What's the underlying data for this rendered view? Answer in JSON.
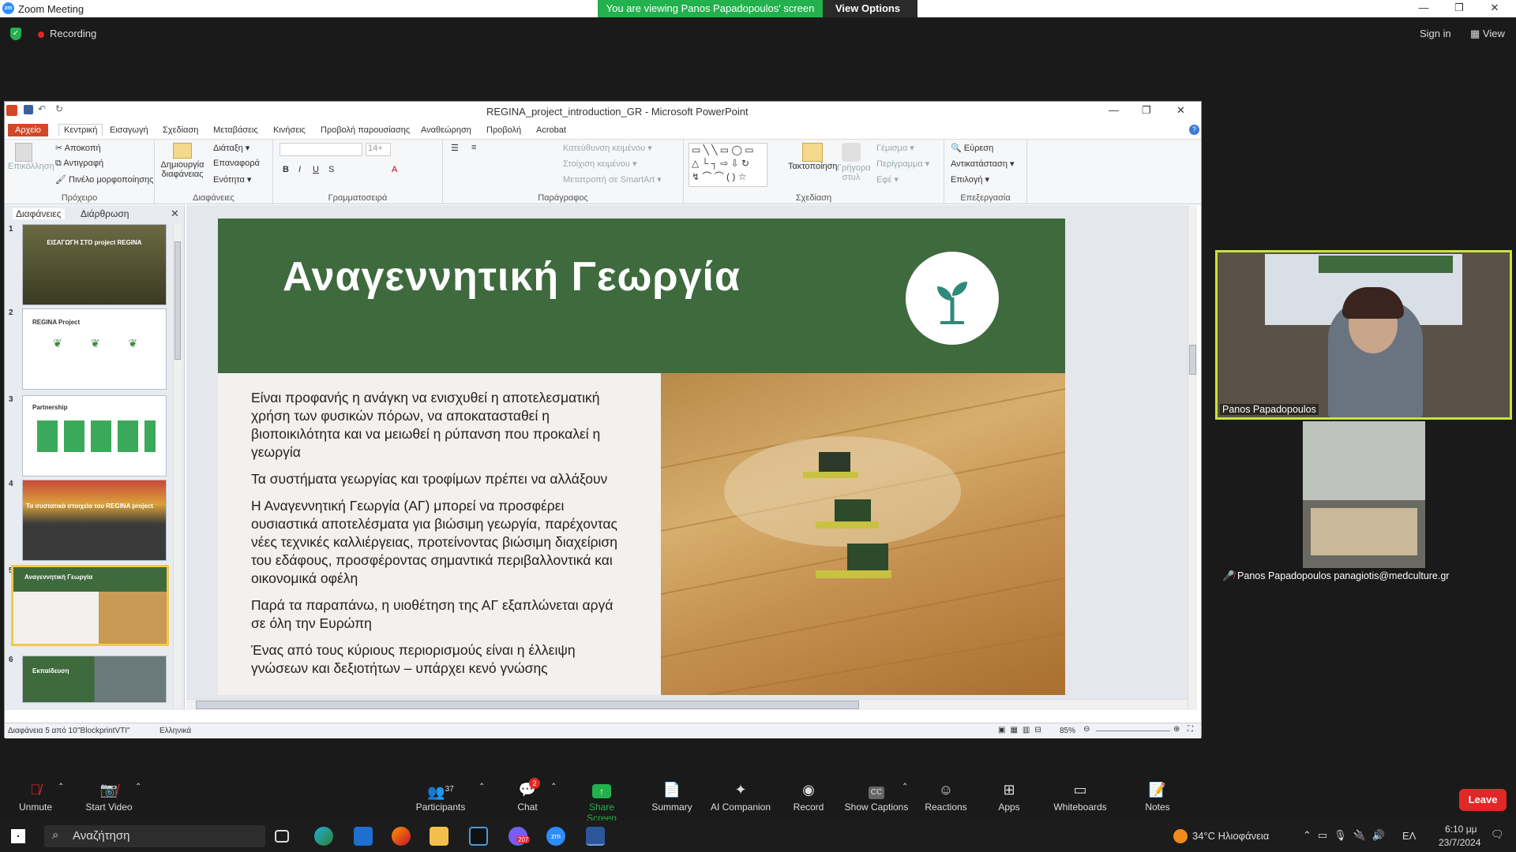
{
  "zoom": {
    "window_title": "Zoom Meeting",
    "logo_text": "zm",
    "banner": "You are viewing Panos Papadopoulos' screen",
    "view_options": "View Options",
    "recording": "Recording",
    "sign_in": "Sign in",
    "view": "View",
    "toolbar": {
      "unmute": "Unmute",
      "start_video": "Start Video",
      "participants": "Participants",
      "participants_count": "37",
      "chat": "Chat",
      "chat_badge": "2",
      "share_screen": "Share Screen",
      "summary": "Summary",
      "ai_companion": "AI Companion",
      "record": "Record",
      "show_captions": "Show Captions",
      "reactions": "Reactions",
      "apps": "Apps",
      "whiteboards": "Whiteboards",
      "notes": "Notes",
      "leave": "Leave"
    },
    "videos": {
      "tile1_name": "Panos Papadopoulos",
      "tile2_name": "Panos Papadopoulos panagiotis@medculture.gr"
    }
  },
  "ppt": {
    "title": "REGINA_project_introduction_GR - Microsoft PowerPoint",
    "menu": [
      "Αρχείο",
      "Κεντρική",
      "Εισαγωγή",
      "Σχεδίαση",
      "Μεταβάσεις",
      "Κινήσεις",
      "Προβολή παρουσίασης",
      "Αναθεώρηση",
      "Προβολή",
      "Acrobat"
    ],
    "ribbon": {
      "clipboard": {
        "label": "Πρόχειρο",
        "paste": "Επικόλληση",
        "cut": "Αποκοπή",
        "copy": "Αντιγραφή",
        "format_painter": "Πινέλο μορφοποίησης"
      },
      "slides": {
        "label": "Διαφάνειες",
        "new_slide": "Δημιουργία διαφάνειας",
        "layout": "Διάταξη",
        "reset": "Επαναφορά",
        "section": "Ενότητα"
      },
      "font": {
        "label": "Γραμματοσειρά",
        "size": "14+"
      },
      "paragraph": {
        "label": "Παράγραφος",
        "text_direction": "Κατεύθυνση κειμένου",
        "align_text": "Στοίχιση κειμένου",
        "smartart": "Μετατροπή σε SmartArt"
      },
      "drawing": {
        "label": "Σχεδίαση",
        "arrange": "Τακτοποίηση",
        "quick_styles": "Γρήγορα στυλ",
        "fill": "Γέμισμα",
        "outline": "Περίγραμμα",
        "effects": "Εφέ"
      },
      "editing": {
        "label": "Επεξεργασία",
        "find": "Εύρεση",
        "replace": "Αντικατάσταση",
        "select": "Επιλογή"
      }
    },
    "panel_tabs": [
      "Διαφάνειες",
      "Διάρθρωση"
    ],
    "thumbnails": [
      {
        "num": "1",
        "title": "ΕΙΣΑΓΩΓΗ ΣΤΟ project REGINA"
      },
      {
        "num": "2",
        "title": "REGINA Project"
      },
      {
        "num": "3",
        "title": "Partnership"
      },
      {
        "num": "4",
        "title": "Τα συστατικά στοιχεία του REGINA project"
      },
      {
        "num": "5",
        "title": "Αναγεννητική Γεωργία"
      },
      {
        "num": "6",
        "title": "Εκπαίδευση"
      }
    ],
    "slide": {
      "title": "Αναγεννητική Γεωργία",
      "paragraphs": [
        "Είναι προφανής η ανάγκη να ενισχυθεί η αποτελεσματική χρήση των φυσικών πόρων, να αποκατασταθεί η βιοποικιλότητα και να μειωθεί η ρύπανση που προκαλεί η γεωργία",
        "Τα συστήματα γεωργίας και τροφίμων πρέπει να αλλάξουν",
        "Η Αναγεννητική Γεωργία (ΑΓ) μπορεί να προσφέρει ουσιαστικά αποτελέσματα για βιώσιμη γεωργία, παρέχοντας νέες τεχνικές καλλιέργειας, προτείνοντας βιώσιμη διαχείριση του εδάφους, προσφέροντας σημαντικά περιβαλλοντικά και οικονομικά οφέλη",
        "Παρά τα παραπάνω, η υιοθέτηση της ΑΓ εξαπλώνεται αργά σε όλη την Ευρώπη",
        "Ένας από τους κύριους περιορισμούς είναι η έλλειψη γνώσεων και δεξιοτήτων – υπάρχει κενό γνώσης"
      ]
    },
    "status": {
      "slide_info": "Διαφάνεια 5 από 10",
      "theme": "\"BlockprintVTI\"",
      "language": "Ελληνικά",
      "zoom": "85%"
    }
  },
  "taskbar": {
    "search": "Αναζήτηση",
    "weather": "34°C Ηλιοφάνεια",
    "lang": "ΕΛ",
    "time": "6:10 μμ",
    "date": "23/7/2024",
    "badge": "207"
  },
  "colors": {
    "slide_green": "#3e6a3e",
    "zoom_green": "#23b14d",
    "leave_red": "#e02828",
    "active_border": "#c8e43a"
  }
}
